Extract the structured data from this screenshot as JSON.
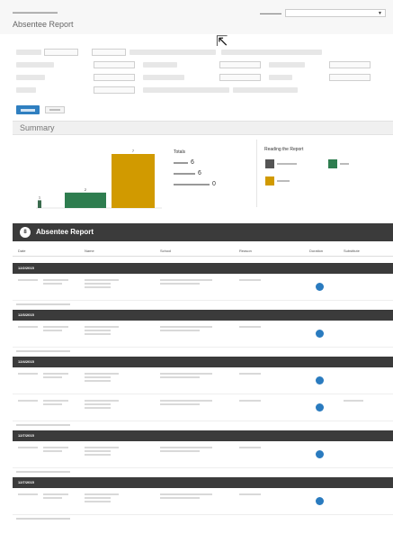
{
  "header": {
    "title": "Absentee Report"
  },
  "summary": {
    "title": "Summary",
    "totals": {
      "heading": "Totals",
      "count_a": "6",
      "count_b": "6",
      "count_c": "0"
    },
    "legend_heading": "Reading the Report"
  },
  "chart_data": {
    "type": "bar",
    "categories": [
      "",
      "",
      ""
    ],
    "values": [
      1,
      2,
      7
    ],
    "colors": [
      "#3a6b4e",
      "#2e7d4f",
      "#d19a00"
    ],
    "ylim": [
      0,
      7
    ]
  },
  "report": {
    "badge": "8",
    "title": "Absentee Report",
    "columns": [
      "Date",
      "",
      "Name",
      "School",
      "Reason",
      "Duration",
      "Substitute"
    ]
  },
  "groups": [
    {
      "date": "12/2/2015",
      "rows": 1
    },
    {
      "date": "12/3/2015",
      "rows": 1
    },
    {
      "date": "12/4/2015",
      "rows": 2
    },
    {
      "date": "12/7/2015",
      "rows": 1
    },
    {
      "date": "12/7/2015",
      "rows": 1
    }
  ],
  "colors": {
    "primary": "#2f7fc0",
    "section_bar": "#3b3b3b",
    "dot": "#2a7bbf"
  }
}
